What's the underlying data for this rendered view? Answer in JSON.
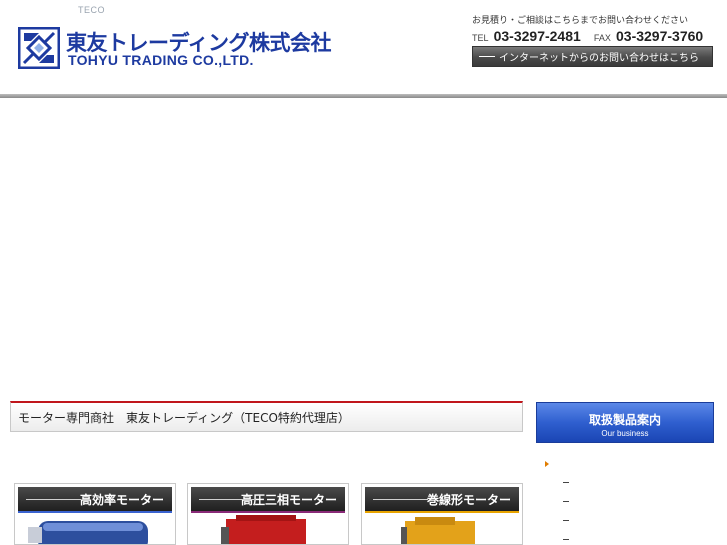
{
  "header": {
    "teco_label": "TECO",
    "company_jp": "東友トレーディング株式会社",
    "company_en": "TOHYU TRADING CO.,LTD.",
    "contact_note": "お見積り・ご相談はこちらまでお問い合わせください",
    "tel_label": "TEL",
    "tel_number": "03-3297-2481",
    "fax_label": "FAX",
    "fax_number": "03-3297-3760",
    "inquiry_button": "インターネットからのお問い合わせはこちら"
  },
  "main": {
    "title": "モーター専門商社　東友トレーディング（TECO特約代理店）"
  },
  "sidebar": {
    "header_jp": "取扱製品案内",
    "header_en": "Our business"
  },
  "products": [
    {
      "label": "高効率モーター"
    },
    {
      "label": "高圧三相モーター"
    },
    {
      "label": "巻線形モーター"
    }
  ],
  "colors": {
    "brand_blue": "#1d3aa0",
    "title_accent_red": "#c0161c",
    "menu_blue": "#2f5fcf",
    "menu_arrow_orange": "#e07c00"
  }
}
